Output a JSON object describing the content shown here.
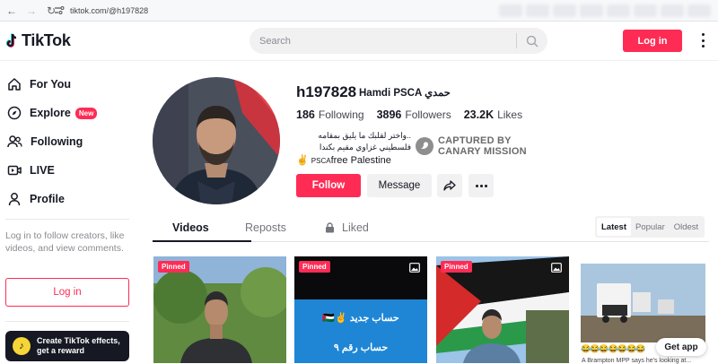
{
  "browser": {
    "url": "tiktok.com/@h197828"
  },
  "header": {
    "logo_text": "TikTok",
    "search_placeholder": "Search",
    "login_label": "Log in"
  },
  "sidebar": {
    "items": [
      {
        "label": "For You",
        "icon": "home-icon"
      },
      {
        "label": "Explore",
        "icon": "compass-icon",
        "badge": "New"
      },
      {
        "label": "Following",
        "icon": "users-icon"
      },
      {
        "label": "LIVE",
        "icon": "live-icon"
      },
      {
        "label": "Profile",
        "icon": "profile-icon"
      }
    ],
    "login_note": "Log in to follow creators, like videos, and view comments.",
    "login_button": "Log in",
    "effects_banner": {
      "line1": "Create TikTok effects,",
      "line2": "get a reward"
    }
  },
  "profile": {
    "username": "h197828",
    "nickname": "Hamdi PSCA حمدي",
    "stats": [
      {
        "value": "186",
        "label": "Following"
      },
      {
        "value": "3896",
        "label": "Followers"
      },
      {
        "value": "23.2K",
        "label": "Likes"
      }
    ],
    "bio_lines": [
      "..واختر لقلبك ما يليق بمقامه",
      "فلسطيني غزاوي مقيم بكندا"
    ],
    "bio_line3_prefix": "✌️",
    "bio_line3_smallcaps": "PSCA",
    "bio_line3_text": "free Palestine",
    "canary": {
      "line1": "CAPTURED BY",
      "line2": "CANARY MISSION"
    },
    "follow_label": "Follow",
    "message_label": "Message"
  },
  "tabs": {
    "items": [
      "Videos",
      "Reposts",
      "Liked"
    ],
    "active": "Videos"
  },
  "sort": {
    "options": [
      "Latest",
      "Popular",
      "Oldest"
    ],
    "selected": "Latest"
  },
  "videos": [
    {
      "pinned_label": "Pinned"
    },
    {
      "pinned_label": "Pinned",
      "text_line1": "حساب جديد ✌️🇵🇸",
      "text_line2": "حساب رقم ٩"
    },
    {
      "pinned_label": "Pinned"
    },
    {
      "emoji": "😂😂😂😂😂😂😂",
      "caption": "A Brampton MPP says he's looking at..."
    }
  ],
  "get_app_label": "Get app",
  "colors": {
    "brand": "#fe2c55",
    "text": "#161823"
  }
}
